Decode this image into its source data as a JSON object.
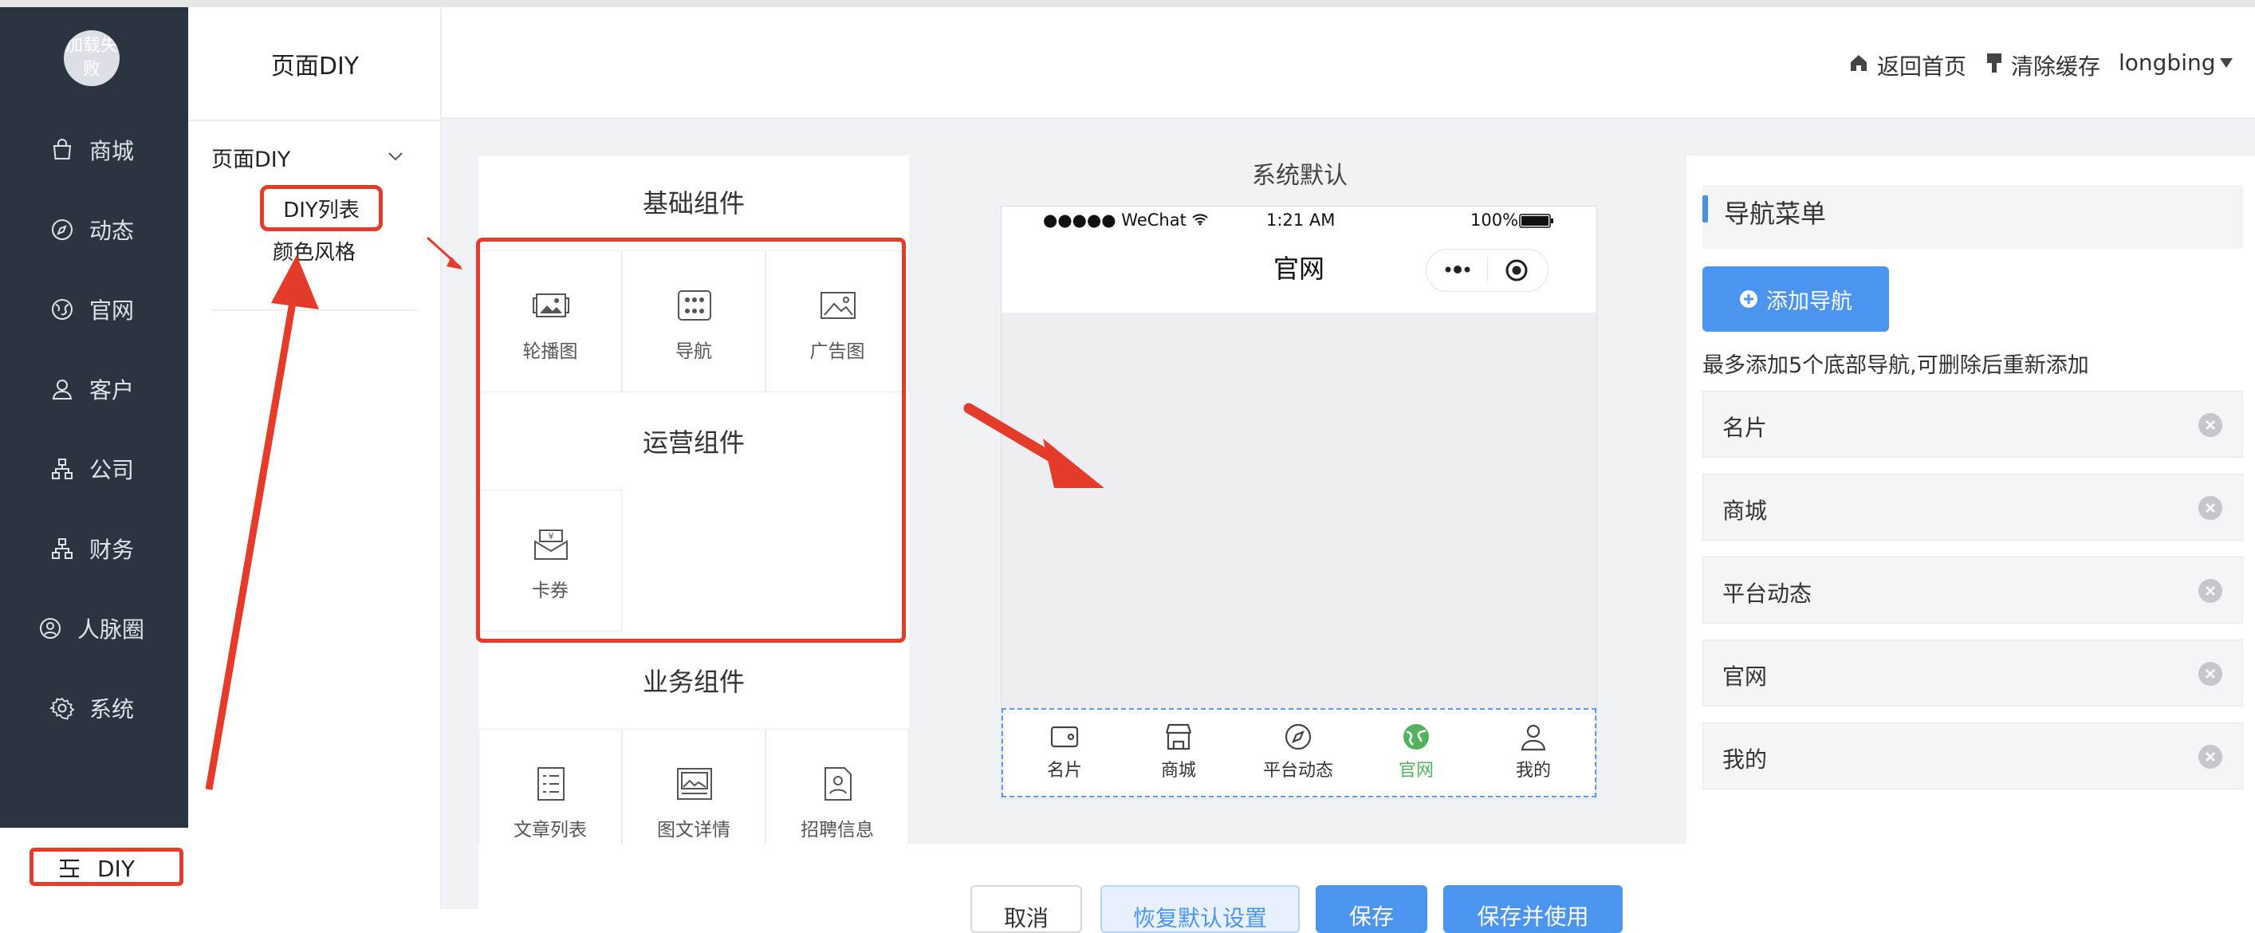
{
  "avatar_text": "加载失败",
  "sidebar": {
    "items": [
      {
        "label": "商城",
        "icon": "shopping-bag-icon"
      },
      {
        "label": "动态",
        "icon": "compass-icon"
      },
      {
        "label": "官网",
        "icon": "globe-icon"
      },
      {
        "label": "客户",
        "icon": "user-icon"
      },
      {
        "label": "公司",
        "icon": "org-chart-icon"
      },
      {
        "label": "财务",
        "icon": "org-chart-icon"
      },
      {
        "label": "人脉圈",
        "icon": "user-circle-icon"
      },
      {
        "label": "系统",
        "icon": "gear-icon"
      }
    ],
    "active_item": {
      "label": "DIY",
      "icon": "diy-menu-icon"
    }
  },
  "subsidebar": {
    "title": "页面DIY",
    "group_title": "页面DIY",
    "items": [
      {
        "label": "DIY列表"
      },
      {
        "label": "颜色风格"
      }
    ]
  },
  "header": {
    "home_label": "返回首页",
    "clear_cache_label": "清除缓存",
    "username": "longbing"
  },
  "components": {
    "basic": {
      "title": "基础组件",
      "items": [
        {
          "label": "轮播图",
          "icon": "carousel-image-icon"
        },
        {
          "label": "导航",
          "icon": "grid-nav-icon"
        },
        {
          "label": "广告图",
          "icon": "ad-image-icon"
        }
      ]
    },
    "operation": {
      "title": "运营组件",
      "items": [
        {
          "label": "卡券",
          "icon": "coupon-icon"
        }
      ]
    },
    "business": {
      "title": "业务组件",
      "items": [
        {
          "label": "文章列表",
          "icon": "article-list-icon"
        },
        {
          "label": "图文详情",
          "icon": "image-text-icon"
        },
        {
          "label": "招聘信息",
          "icon": "recruit-icon"
        }
      ]
    }
  },
  "preview": {
    "title": "系统默认",
    "status_left": "●●●●● WeChat",
    "status_time": "1:21 AM",
    "status_battery": "100%",
    "page_title": "官网",
    "tabs": [
      {
        "label": "名片",
        "icon": "card-icon",
        "active": false
      },
      {
        "label": "商城",
        "icon": "store-icon",
        "active": false
      },
      {
        "label": "平台动态",
        "icon": "compass-icon",
        "active": false
      },
      {
        "label": "官网",
        "icon": "globe-icon",
        "active": true
      },
      {
        "label": "我的",
        "icon": "user-icon",
        "active": false
      }
    ],
    "active_color": "#53b160"
  },
  "nav_menu": {
    "title": "导航菜单",
    "add_button": "添加导航",
    "hint": "最多添加5个底部导航,可删除后重新添加",
    "items": [
      {
        "label": "名片"
      },
      {
        "label": "商城"
      },
      {
        "label": "平台动态"
      },
      {
        "label": "官网"
      },
      {
        "label": "我的"
      }
    ]
  },
  "footer_buttons": {
    "cancel": "取消",
    "restore": "恢复默认设置",
    "save": "保存",
    "save_and_use": "保存并使用"
  },
  "colors": {
    "sidebar_bg": "#2b3541",
    "primary": "#4b94f0",
    "annotation_red": "#e53b2b"
  }
}
